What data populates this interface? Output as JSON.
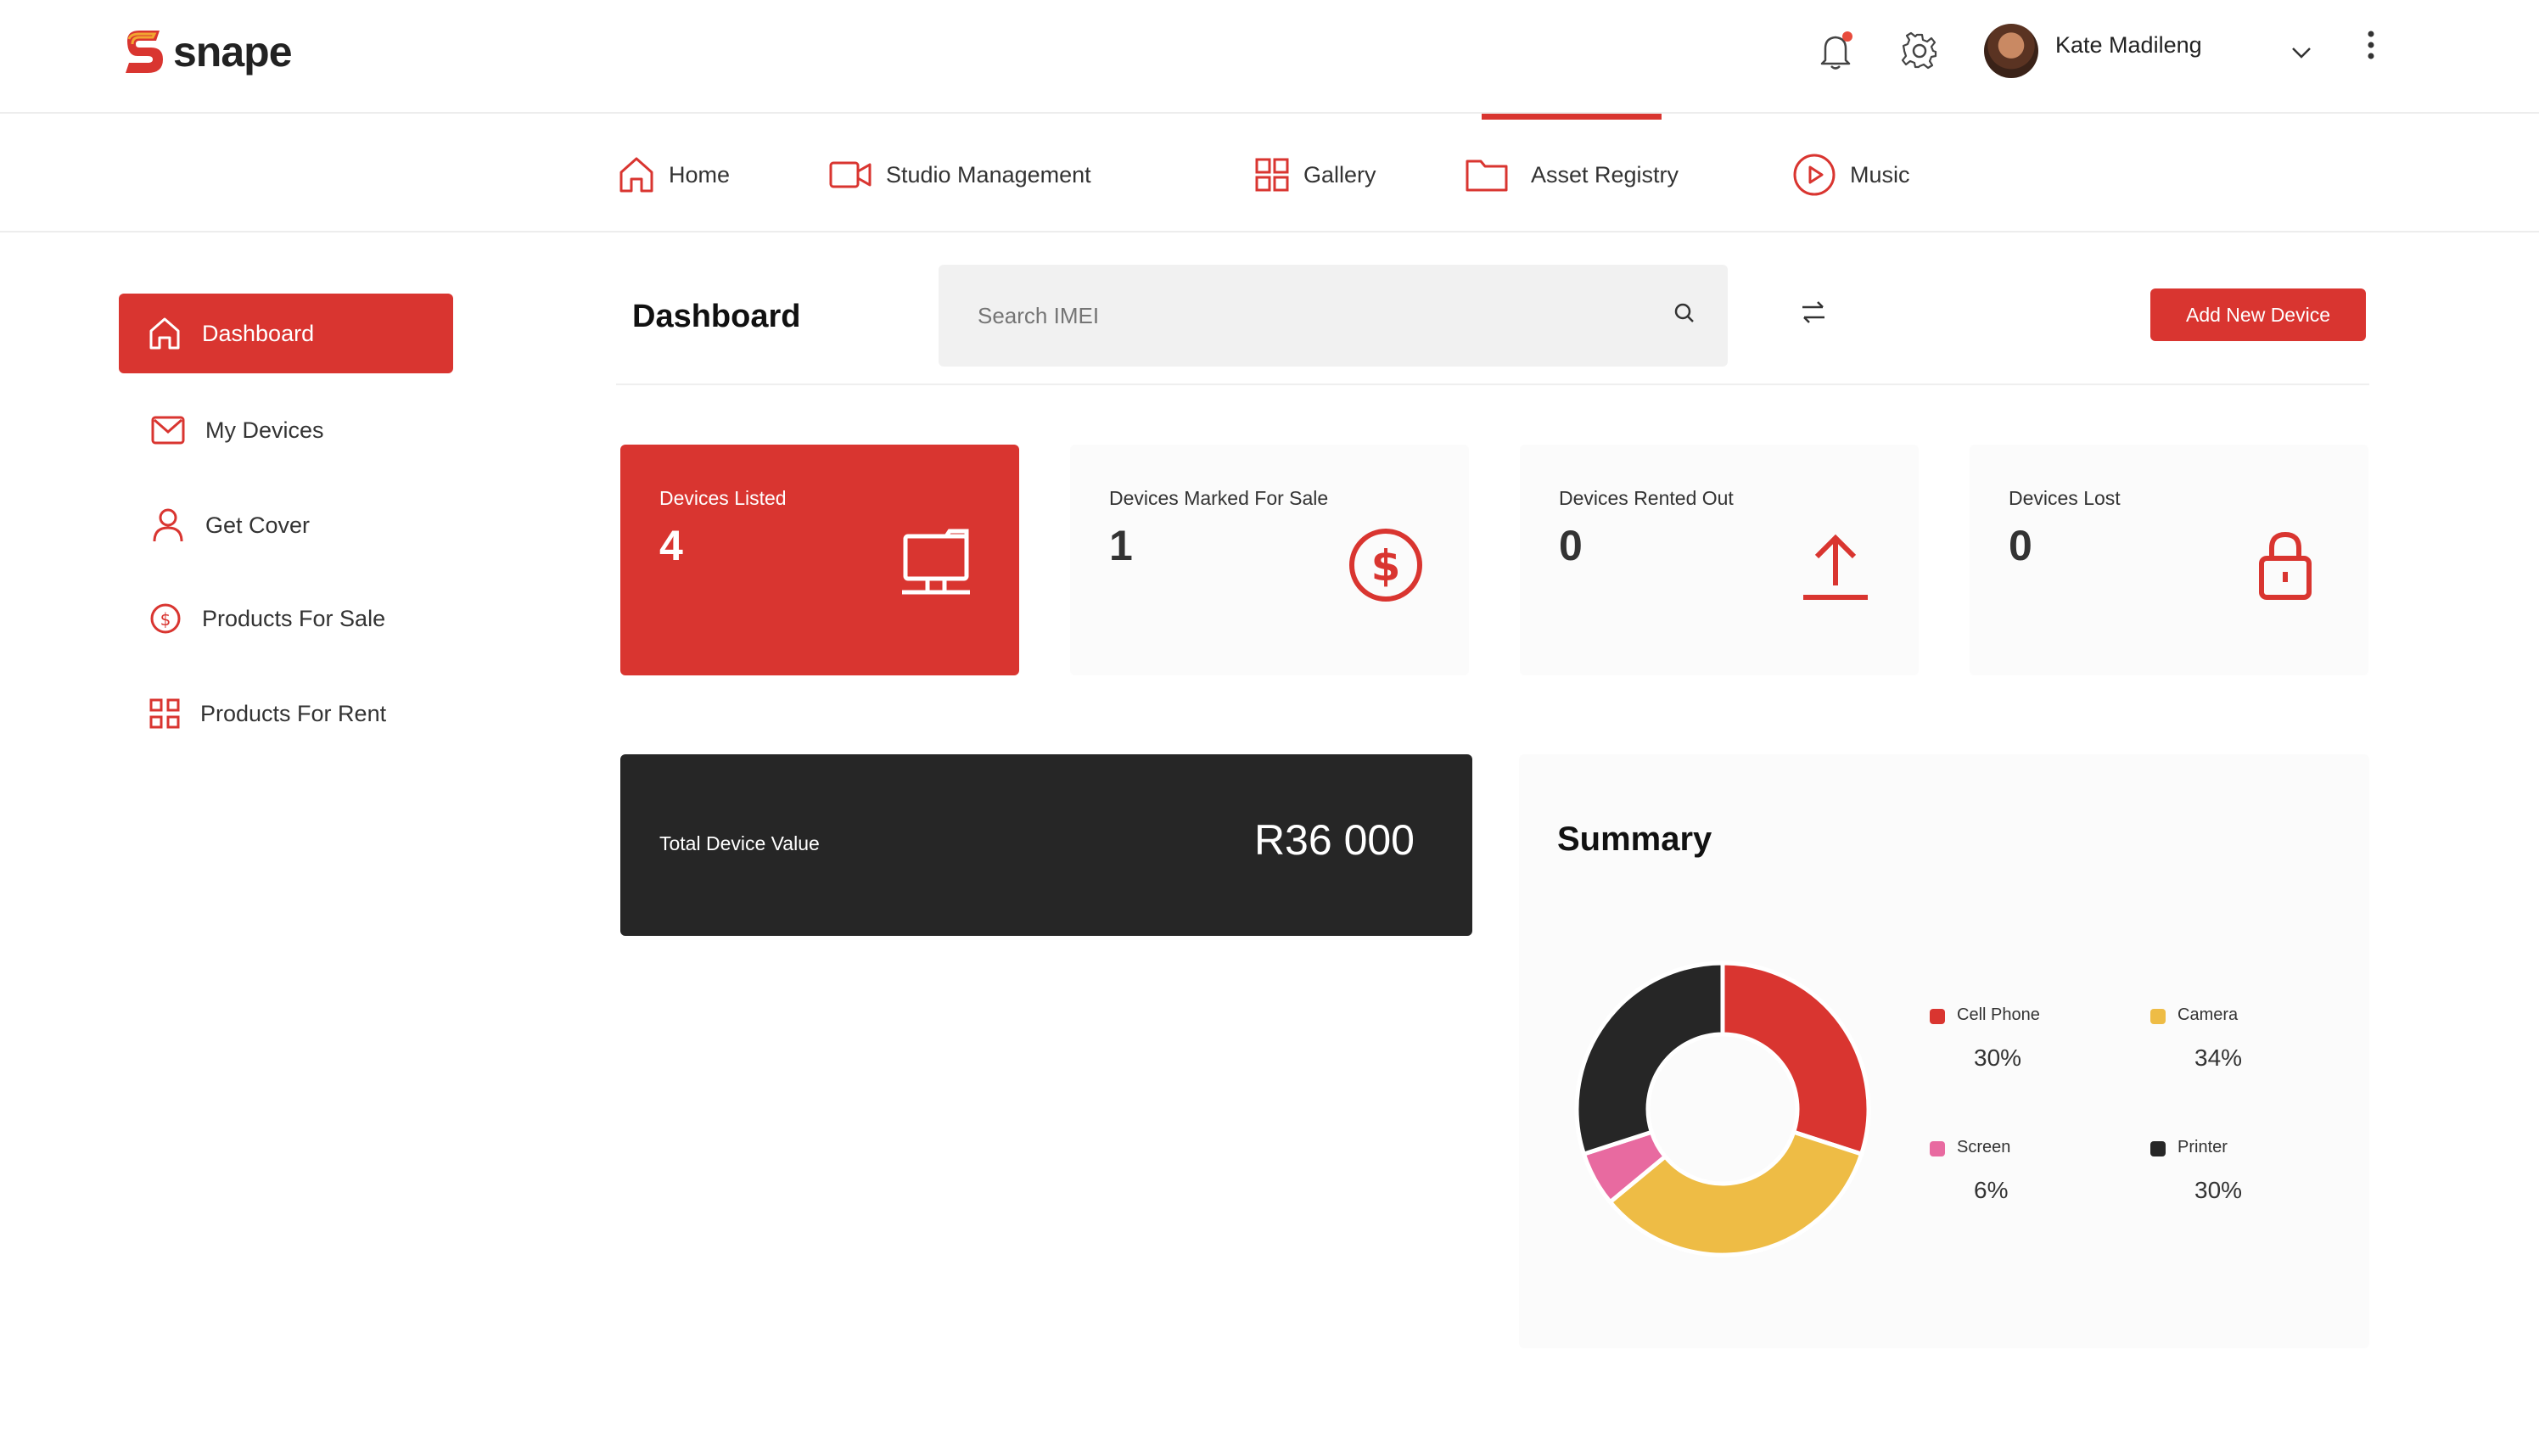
{
  "app": {
    "brand": "snape",
    "accent": "#d93530",
    "dark": "#262626"
  },
  "topbar": {
    "user_name": "Kate Madileng",
    "icons": [
      "bell-icon",
      "gear-icon",
      "chevron-down-icon",
      "kebab-menu-icon"
    ]
  },
  "nav": {
    "active": "Asset Registry",
    "items": [
      {
        "label": "Home",
        "icon": "home-icon"
      },
      {
        "label": "Studio Management",
        "icon": "video-camera-icon"
      },
      {
        "label": "Gallery",
        "icon": "grid-icon"
      },
      {
        "label": "Asset Registry",
        "icon": "folder-icon"
      },
      {
        "label": "Music",
        "icon": "play-circle-icon"
      }
    ]
  },
  "sidebar": {
    "active": "Dashboard",
    "items": [
      {
        "label": "Dashboard",
        "icon": "home-icon"
      },
      {
        "label": "My Devices",
        "icon": "mail-icon"
      },
      {
        "label": "Get Cover",
        "icon": "user-icon"
      },
      {
        "label": "Products For Sale",
        "icon": "dollar-circle-icon"
      },
      {
        "label": "Products For Rent",
        "icon": "grid-icon"
      }
    ]
  },
  "header": {
    "title": "Dashboard",
    "search_placeholder": "Search IMEI",
    "add_button": "Add New Device"
  },
  "stats": [
    {
      "label": "Devices Listed",
      "value": "4",
      "icon": "laptop-icon"
    },
    {
      "label": "Devices Marked For Sale",
      "value": "1",
      "icon": "dollar-circle-icon"
    },
    {
      "label": "Devices Rented Out",
      "value": "0",
      "icon": "upload-arrow-icon"
    },
    {
      "label": "Devices Lost",
      "value": "0",
      "icon": "lock-icon"
    }
  ],
  "total": {
    "label": "Total Device Value",
    "value": "R36 000"
  },
  "summary": {
    "title": "Summary",
    "legend": [
      {
        "name": "Cell Phone",
        "pct": "30%"
      },
      {
        "name": "Camera",
        "pct": "34%"
      },
      {
        "name": "Screen",
        "pct": "6%"
      },
      {
        "name": "Printer",
        "pct": "30%"
      }
    ]
  },
  "chart_data": {
    "type": "pie",
    "categories": [
      "Cell Phone",
      "Camera",
      "Screen",
      "Printer"
    ],
    "values": [
      30,
      34,
      6,
      30
    ],
    "colors": [
      "#d93530",
      "#eebc45",
      "#e86aa0",
      "#262626"
    ],
    "title": "Summary",
    "legend": "right"
  }
}
